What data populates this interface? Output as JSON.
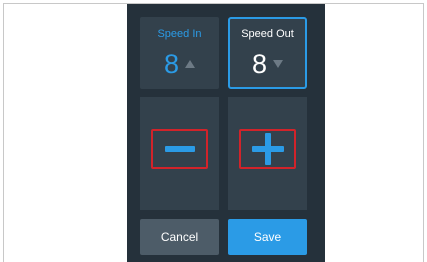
{
  "speed_in": {
    "label": "Speed In",
    "value": "8",
    "direction_icon": "triangle-up-icon",
    "color": "#2b9be6"
  },
  "speed_out": {
    "label": "Speed Out",
    "value": "8",
    "direction_icon": "triangle-down-icon",
    "selected": true,
    "color": "#ffffff"
  },
  "controls": {
    "decrement_icon": "minus-icon",
    "increment_icon": "plus-icon",
    "highlight_color": "#d2232a"
  },
  "actions": {
    "cancel_label": "Cancel",
    "save_label": "Save"
  },
  "theme": {
    "background": "#25313b",
    "tile": "#33414c",
    "accent": "#2b9be6",
    "cancel_bg": "#4d5c68"
  }
}
